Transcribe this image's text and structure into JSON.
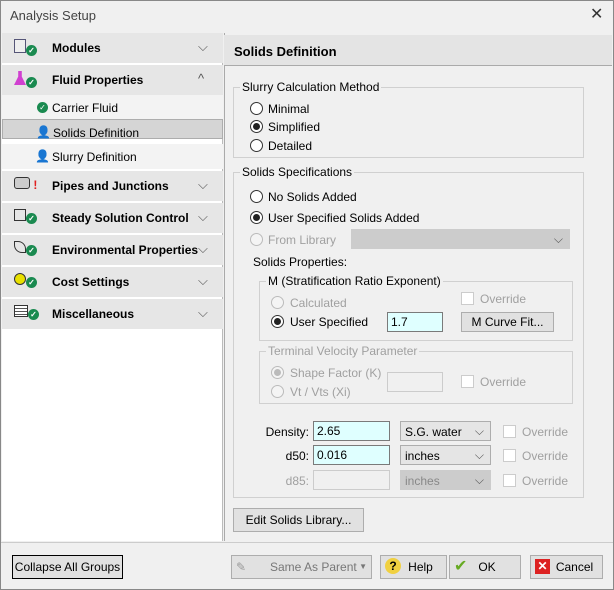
{
  "window": {
    "title": "Analysis Setup",
    "close": "✕"
  },
  "sidebar": {
    "groups": [
      {
        "label": "Modules",
        "expanded": false,
        "status": "ok"
      },
      {
        "label": "Fluid Properties",
        "expanded": true,
        "status": "ok",
        "items": [
          {
            "label": "Carrier Fluid",
            "status": "ok"
          },
          {
            "label": "Solids Definition",
            "status": "user-edit",
            "selected": true
          },
          {
            "label": "Slurry Definition",
            "status": "user-edit"
          }
        ]
      },
      {
        "label": "Pipes and Junctions",
        "expanded": false,
        "status": "error"
      },
      {
        "label": "Steady Solution Control",
        "expanded": false,
        "status": "ok"
      },
      {
        "label": "Environmental Properties",
        "expanded": false,
        "status": "ok"
      },
      {
        "label": "Cost Settings",
        "expanded": false,
        "status": "ok"
      },
      {
        "label": "Miscellaneous",
        "expanded": false,
        "status": "ok"
      }
    ],
    "chev_down": "⌵",
    "chev_up": "^"
  },
  "panel": {
    "title": "Solids Definition",
    "slurry_method": {
      "legend": "Slurry Calculation Method",
      "options": [
        "Minimal",
        "Simplified",
        "Detailed"
      ],
      "selected": "Simplified"
    },
    "specs": {
      "legend": "Solids Specifications",
      "options": [
        "No Solids Added",
        "User Specified Solids Added",
        "From Library"
      ],
      "selected": "User Specified Solids Added",
      "library_value": ""
    },
    "properties_label": "Solids Properties:",
    "m": {
      "legend": "M (Stratification Ratio Exponent)",
      "calculated": "Calculated",
      "user_specified": "User Specified",
      "value": "1.7",
      "override": "Override",
      "curve_fit": "M Curve Fit..."
    },
    "terminal": {
      "legend": "Terminal Velocity Parameter",
      "shape_factor": "Shape Factor (K)",
      "vt": "Vt / Vts (Xi)",
      "value": "",
      "override": "Override"
    },
    "density": {
      "label": "Density:",
      "value": "2.65",
      "unit": "S.G. water",
      "override": "Override"
    },
    "d50": {
      "label": "d50:",
      "value": "0.016",
      "unit": "inches",
      "override": "Override"
    },
    "d85": {
      "label": "d85:",
      "value": "",
      "unit": "inches",
      "override": "Override"
    },
    "edit_library": "Edit Solids Library..."
  },
  "footer": {
    "collapse": "Collapse All Groups",
    "same_as_parent": "Same As Parent",
    "help": "Help",
    "ok": "OK",
    "cancel": "Cancel"
  }
}
